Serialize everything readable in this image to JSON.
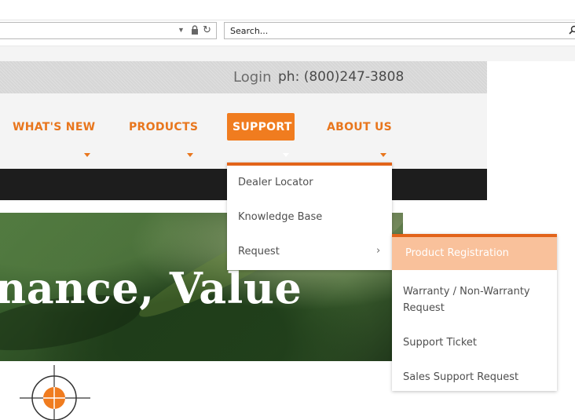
{
  "browser": {
    "search_placeholder": "Search..."
  },
  "topbar": {
    "login": "Login",
    "phone": "ph: (800)247-3808"
  },
  "nav": {
    "items": [
      {
        "label": "WHAT'S NEW"
      },
      {
        "label": "PRODUCTS"
      },
      {
        "label": "SUPPORT",
        "active": true
      },
      {
        "label": "ABOUT US"
      }
    ]
  },
  "support_menu": {
    "items": [
      {
        "label": "Dealer Locator"
      },
      {
        "label": "Knowledge Base"
      },
      {
        "label": "Request",
        "has_submenu": true
      }
    ]
  },
  "request_menu": {
    "items": [
      {
        "label": "Product Registration",
        "highlighted": true
      },
      {
        "label": "Warranty / Non-Warranty Request"
      },
      {
        "label": "Support Ticket"
      },
      {
        "label": "Sales Support Request"
      }
    ]
  },
  "hero": {
    "headline": "nance, Value"
  },
  "colors": {
    "accent": "#e8761d",
    "accent_dark": "#e2641a",
    "highlight": "#f9c19b",
    "band": "#1d1d1d"
  }
}
